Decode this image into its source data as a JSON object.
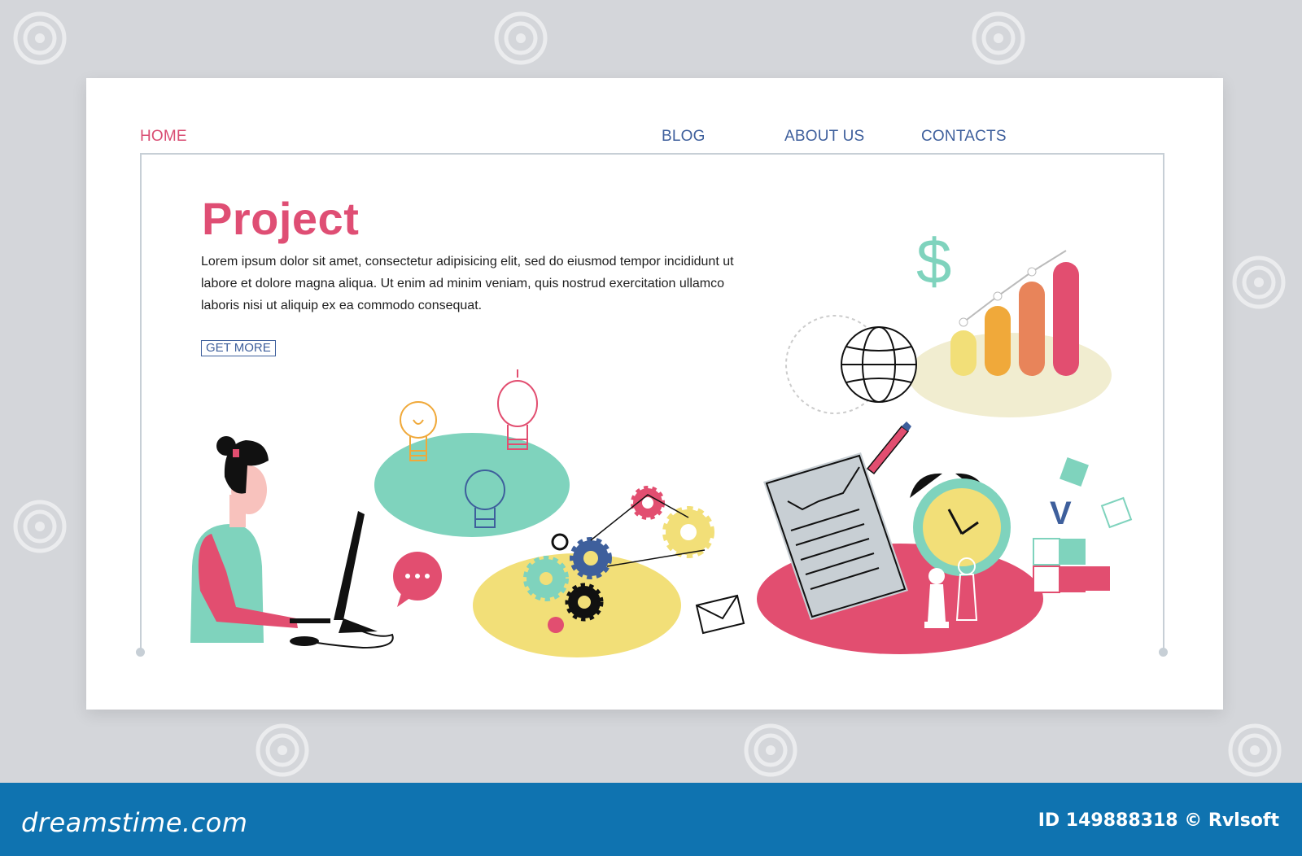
{
  "nav": {
    "home": "HOME",
    "blog": "BLOG",
    "about": "ABOUT US",
    "contacts": "CONTACTS"
  },
  "hero": {
    "title": "Project",
    "body": "Lorem ipsum dolor sit amet, consectetur adipisicing elit, sed do eiusmod tempor incididunt ut labore et dolore magna aliqua. Ut enim ad minim veniam, quis nostrud exercitation ullamco laboris nisi ut aliquip ex ea commodo consequat.",
    "cta_label": "GET MORE"
  },
  "illustration": {
    "dollar_sign": "$",
    "check_mark": "V",
    "icons": [
      "woman-at-computer",
      "lightbulb-icon",
      "speech-bubble-icon",
      "gears-icon",
      "envelope-icon",
      "document-chart-icon",
      "pencil-icon",
      "alarm-clock-icon",
      "chess-pawn-icon",
      "puzzle-icon",
      "globe-icon",
      "bar-chart-icon",
      "dollar-icon"
    ]
  },
  "footer": {
    "logo": "dreamstime.com",
    "image_id": "ID 149888318 © Rvlsoft"
  },
  "colors": {
    "accent_pink": "#df4e74",
    "nav_blue": "#3e5f9c",
    "mint": "#7fd3bd",
    "yellow": "#f2df78",
    "footer_blue": "#0f73b0"
  }
}
